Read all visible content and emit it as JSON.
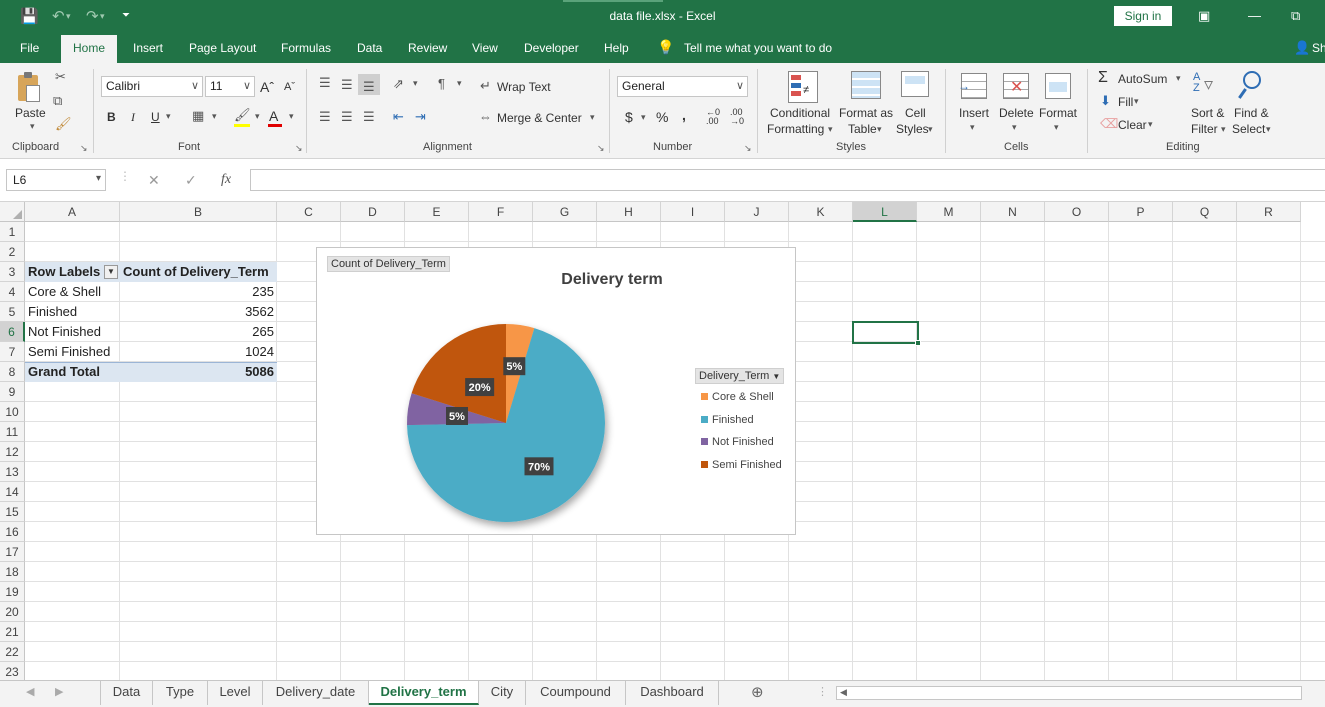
{
  "titlebar": {
    "title": "data file.xlsx  -  Excel",
    "sign_in": "Sign in"
  },
  "menu": {
    "tabs": [
      "File",
      "Home",
      "Insert",
      "Page Layout",
      "Formulas",
      "Data",
      "Review",
      "View",
      "Developer",
      "Help"
    ],
    "tell_me": "Tell me what you want to do",
    "share": "Sh"
  },
  "ribbon": {
    "clipboard": {
      "paste": "Paste",
      "label": "Clipboard"
    },
    "font": {
      "name": "Calibri",
      "size": "11",
      "label": "Font",
      "bold": "B",
      "italic": "I",
      "underline": "U"
    },
    "alignment": {
      "wrap": "Wrap Text",
      "merge": "Merge & Center",
      "label": "Alignment"
    },
    "number": {
      "format": "General",
      "currency": "$",
      "percent": "%",
      "comma": ",",
      "label": "Number"
    },
    "styles": {
      "conditional_1": "Conditional",
      "conditional_2": "Formatting",
      "format_table_1": "Format as",
      "format_table_2": "Table",
      "cell_styles_1": "Cell",
      "cell_styles_2": "Styles",
      "label": "Styles"
    },
    "cells": {
      "insert": "Insert",
      "delete": "Delete",
      "format": "Format",
      "label": "Cells"
    },
    "editing": {
      "autosum": "AutoSum",
      "fill": "Fill",
      "clear": "Clear",
      "sort_1": "Sort &",
      "sort_2": "Filter",
      "find_1": "Find &",
      "find_2": "Select",
      "label": "Editing"
    }
  },
  "formula_bar": {
    "name_box": "L6",
    "fx": "fx",
    "cancel": "✕",
    "enter": "✓",
    "value": ""
  },
  "grid": {
    "columns": [
      "A",
      "B",
      "C",
      "D",
      "E",
      "F",
      "G",
      "H",
      "I",
      "J",
      "K",
      "L",
      "M",
      "N",
      "O",
      "P",
      "Q",
      "R"
    ],
    "rows": [
      "1",
      "2",
      "3",
      "4",
      "5",
      "6",
      "7",
      "8",
      "9",
      "10",
      "11",
      "12",
      "13",
      "14",
      "15",
      "16",
      "17",
      "18",
      "19",
      "20",
      "21",
      "22",
      "23"
    ]
  },
  "pivot": {
    "header_row_labels": "Row Labels",
    "header_count": "Count of Delivery_Term",
    "rows": [
      {
        "label": "Core & Shell",
        "value": "235"
      },
      {
        "label": "Finished",
        "value": "3562"
      },
      {
        "label": "Not Finished",
        "value": "265"
      },
      {
        "label": "Semi Finished",
        "value": "1024"
      }
    ],
    "total_label": "Grand Total",
    "total_value": "5086"
  },
  "chart_data": {
    "type": "pie",
    "title": "Delivery term",
    "value_field_button": "Count of Delivery_Term",
    "legend_field_button": "Delivery_Term",
    "legend_position": "right",
    "categories": [
      "Core & Shell",
      "Finished",
      "Not Finished",
      "Semi Finished"
    ],
    "values": [
      235,
      3562,
      265,
      1024
    ],
    "data_labels": [
      "5%",
      "70%",
      "5%",
      "20%"
    ],
    "colors": [
      "#f79646",
      "#4bacc6",
      "#8064a2",
      "#c0560c"
    ]
  },
  "sheets": {
    "tabs": [
      "Data",
      "Type",
      "Level",
      "Delivery_date",
      "Delivery_term",
      "City",
      "Coumpound",
      "Dashboard"
    ],
    "active": "Delivery_term",
    "add": "⊕"
  },
  "colors": {
    "accent": "#217346"
  }
}
